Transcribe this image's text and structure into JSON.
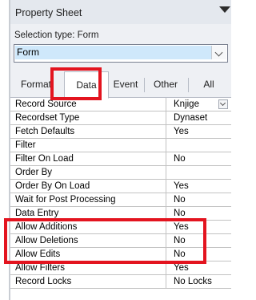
{
  "panel": {
    "title": "Property Sheet",
    "selection_label": "Selection type:",
    "selection_value": "Form",
    "combo_value": "Form"
  },
  "tabs": [
    {
      "label": "Format",
      "selected": false
    },
    {
      "label": "Data",
      "selected": true
    },
    {
      "label": "Event",
      "selected": false
    },
    {
      "label": "Other",
      "selected": false
    },
    {
      "label": "All",
      "selected": false
    }
  ],
  "properties": [
    {
      "name": "Record Source",
      "value": "Knjige"
    },
    {
      "name": "Recordset Type",
      "value": "Dynaset"
    },
    {
      "name": "Fetch Defaults",
      "value": "Yes"
    },
    {
      "name": "Filter",
      "value": ""
    },
    {
      "name": "Filter On Load",
      "value": "No"
    },
    {
      "name": "Order By",
      "value": ""
    },
    {
      "name": "Order By On Load",
      "value": "Yes"
    },
    {
      "name": "Wait for Post Processing",
      "value": "No"
    },
    {
      "name": "Data Entry",
      "value": "No"
    },
    {
      "name": "Allow Additions",
      "value": "Yes"
    },
    {
      "name": "Allow Deletions",
      "value": "No"
    },
    {
      "name": "Allow Edits",
      "value": "No"
    },
    {
      "name": "Allow Filters",
      "value": "Yes"
    },
    {
      "name": "Record Locks",
      "value": "No Locks"
    }
  ],
  "highlight_color": "#e3141f"
}
